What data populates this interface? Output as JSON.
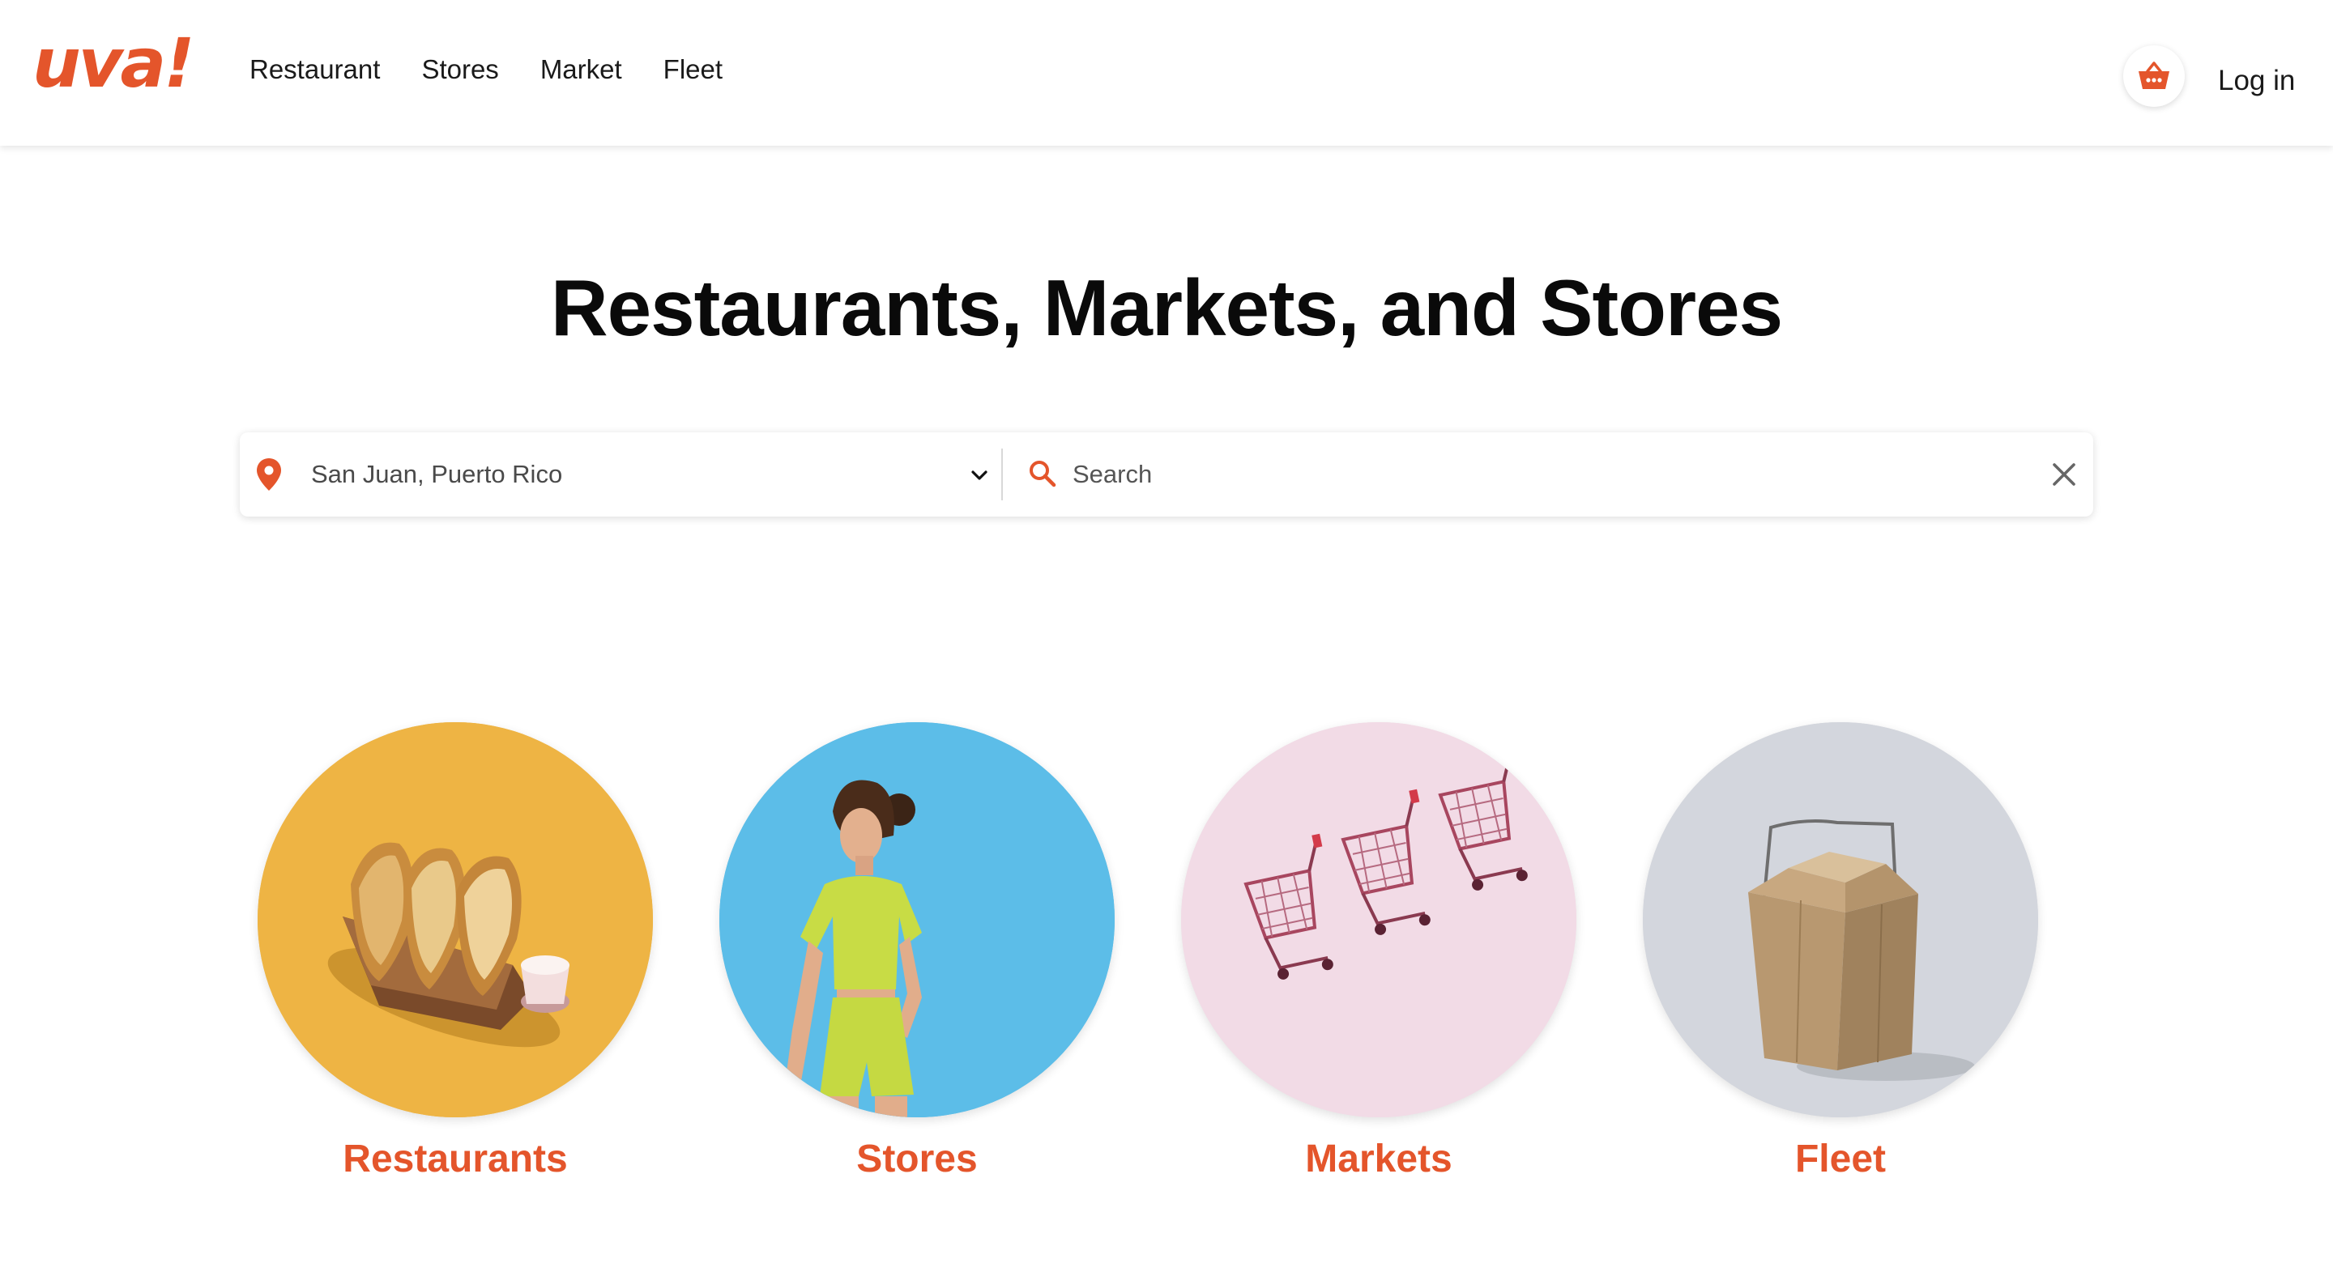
{
  "header": {
    "logo_text": "uva!",
    "nav": [
      {
        "label": "Restaurant"
      },
      {
        "label": "Stores"
      },
      {
        "label": "Market"
      },
      {
        "label": "Fleet"
      }
    ],
    "cart_icon": "basket-icon",
    "login_label": "Log in"
  },
  "hero": {
    "title": "Restaurants, Markets, and Stores"
  },
  "search": {
    "location_icon": "map-pin-icon",
    "location_value": "San Juan, Puerto Rico",
    "location_dropdown_icon": "chevron-down-icon",
    "search_icon": "search-icon",
    "placeholder": "Search",
    "clear_icon": "close-icon"
  },
  "categories": [
    {
      "label": "Restaurants",
      "image": "empanadas-photo",
      "bg_color": "#eeb444"
    },
    {
      "label": "Stores",
      "image": "fashion-model-photo",
      "bg_color": "#5cbde8"
    },
    {
      "label": "Markets",
      "image": "shopping-carts-photo",
      "bg_color": "#f2dbe6"
    },
    {
      "label": "Fleet",
      "image": "takeout-box-photo",
      "bg_color": "#d3d6dd"
    }
  ],
  "colors": {
    "brand": "#e4552b",
    "text": "#111111"
  }
}
